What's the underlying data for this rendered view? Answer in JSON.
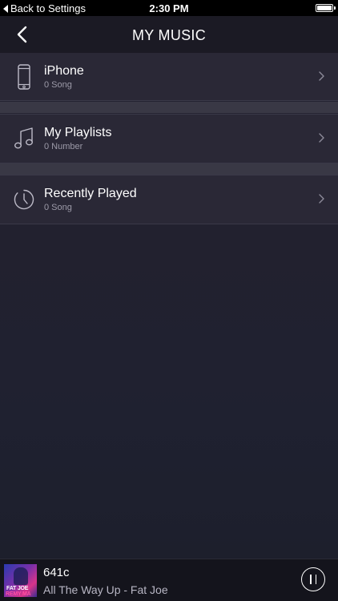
{
  "status_bar": {
    "back_label": "Back to Settings",
    "time": "2:30 PM"
  },
  "nav": {
    "title": "MY MUSIC",
    "back_icon": "chevron-left-icon"
  },
  "rows": [
    {
      "title": "iPhone",
      "subtitle": "0 Song",
      "icon": "phone-icon"
    },
    {
      "title": "My Playlists",
      "subtitle": "0 Number",
      "icon": "music-note-icon"
    },
    {
      "title": "Recently Played",
      "subtitle": "0 Song",
      "icon": "clock-icon"
    }
  ],
  "now_playing": {
    "track": "641c",
    "artist_line": "All The Way Up - Fat Joe",
    "album_text_1": "FAT JOE",
    "album_text_2": "REMY MA"
  },
  "colors": {
    "background": "#22212f",
    "row": "#2a2836",
    "nav": "#1b1a24",
    "player": "#14141c"
  }
}
